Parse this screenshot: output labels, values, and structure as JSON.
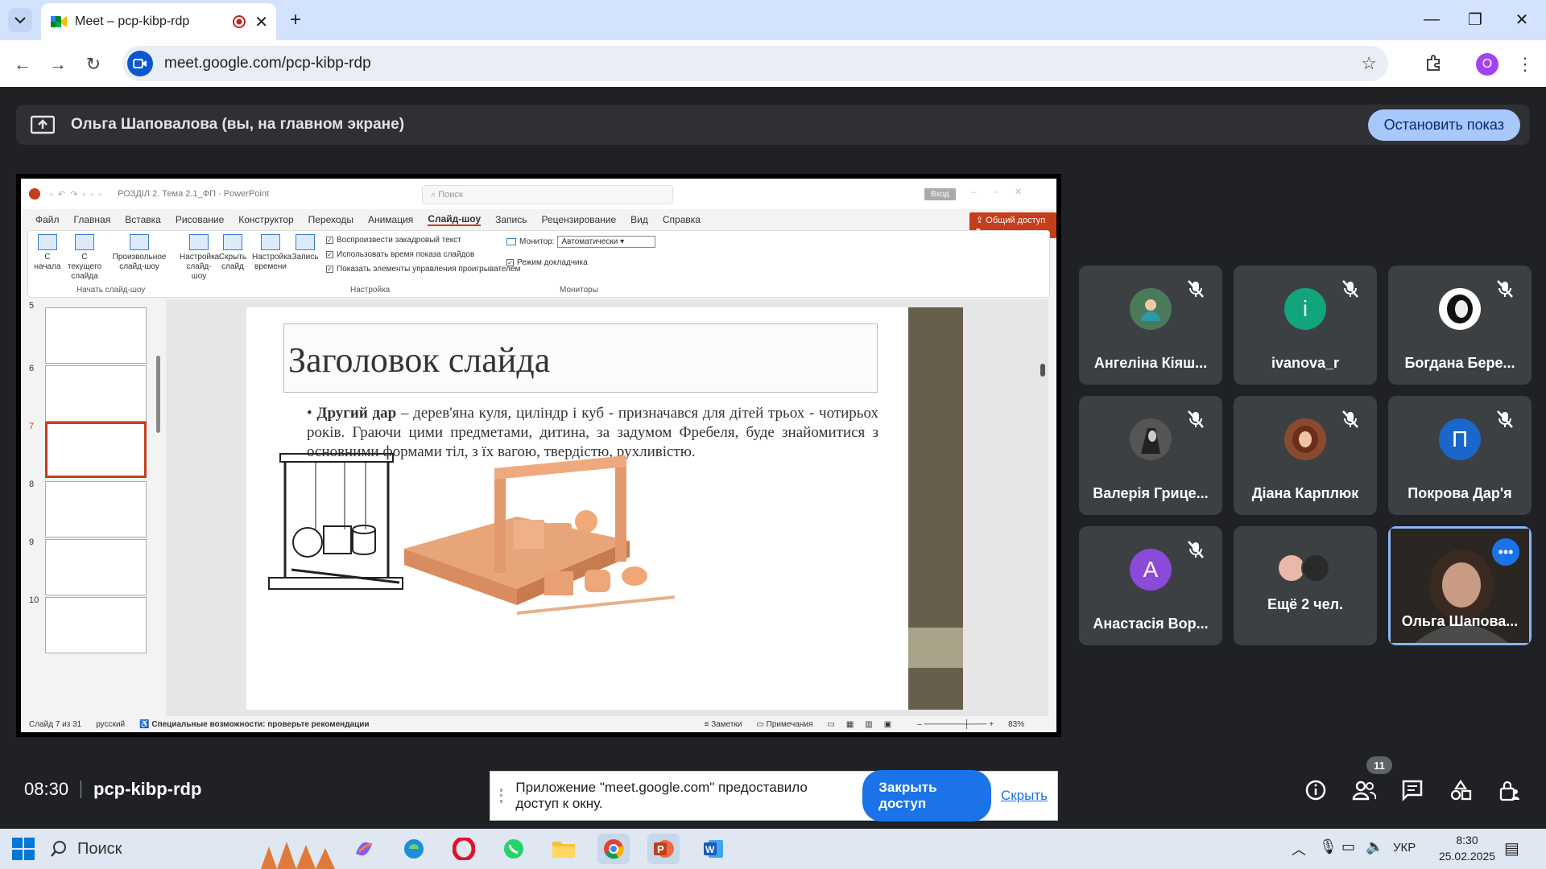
{
  "browser": {
    "tab_title": "Meet – pcp-kibp-rdp",
    "url": "meet.google.com/pcp-kibp-rdp",
    "profile_initial": "O"
  },
  "meet": {
    "present_banner": "Ольга Шаповалова (вы, на главном экране)",
    "stop_button": "Остановить показ",
    "time": "08:30",
    "code": "pcp-kibp-rdp",
    "people_count": "11",
    "share_notice": "Приложение \"meet.google.com\" предоставило доступ к окну.",
    "close_access": "Закрыть доступ",
    "hide": "Скрыть",
    "participants": [
      {
        "name": "Ангеліна Кіяш...",
        "initial": "",
        "color": "#4a7a5a",
        "muted": true
      },
      {
        "name": "ivanova_r",
        "initial": "i",
        "color": "#12a47a",
        "muted": true
      },
      {
        "name": "Богдана Бере...",
        "initial": "",
        "color": "#ffffff",
        "muted": true
      },
      {
        "name": "Валерія Грице...",
        "initial": "",
        "color": "#555555",
        "muted": true
      },
      {
        "name": "Діана Карплюк",
        "initial": "",
        "color": "#8a4a30",
        "muted": true
      },
      {
        "name": "Покрова Дар'я",
        "initial": "П",
        "color": "#1a66c9",
        "muted": true
      },
      {
        "name": "Анастасія Вор...",
        "initial": "A",
        "color": "#8b4ad8",
        "muted": true
      },
      {
        "name": "Ещё 2 чел.",
        "initial": "",
        "color": "#3c4043",
        "muted": false
      },
      {
        "name": "Ольга Шапова...",
        "initial": "",
        "color": "#1e1e1e",
        "muted": false
      }
    ]
  },
  "ppt": {
    "doc_title": "РОЗДІЛ 2. Тема 2.1_ФП  ·  PowerPoint",
    "search_placeholder": "Поиск",
    "signin": "Вход",
    "share": "Общий доступ",
    "menu": [
      "Файл",
      "Главная",
      "Вставка",
      "Рисование",
      "Конструктор",
      "Переходы",
      "Анимация",
      "Слайд-шоу",
      "Запись",
      "Рецензирование",
      "Вид",
      "Справка"
    ],
    "ribbon": {
      "from_start": "С начала",
      "from_current": "С текущего слайда",
      "custom": "Произвольное слайд-шоу",
      "setup": "Настройка слайд-шоу",
      "hide_slide": "Скрыть слайд",
      "rehearse": "Настройка времени",
      "record": "Запись",
      "chk_narration": "Воспроизвести закадровый текст",
      "chk_timings": "Использовать время показа слайдов",
      "chk_controls": "Показать элементы управления проигрывателем",
      "monitor_label": "Монитор:",
      "monitor_value": "Автоматически",
      "chk_presenter": "Режим докладчика",
      "grp_start": "Начать слайд-шоу",
      "grp_setup": "Настройка",
      "grp_monitors": "Мониторы"
    },
    "thumb_numbers": [
      "5",
      "6",
      "7",
      "8",
      "9",
      "10"
    ],
    "slide_title": "Заголовок слайда",
    "slide_lead": "Другий дар",
    "slide_body": " – дерев'яна куля, циліндр і куб - призначався для дітей трьох - чотирьох років. Граючи цими предметами, дитина, за задумом Фребеля, буде знайомитися з основними формами тіл, з їх вагою, твердістю, рухливістю.",
    "status": {
      "slide": "Слайд 7 из 31",
      "lang": "русский",
      "accessibility": "Специальные возможности: проверьте рекомендации",
      "notes": "Заметки",
      "comments": "Примечания",
      "zoom": "83%"
    }
  },
  "taskbar": {
    "search": "Поиск",
    "lang": "УКР",
    "time": "8:30",
    "date": "25.02.2025"
  }
}
